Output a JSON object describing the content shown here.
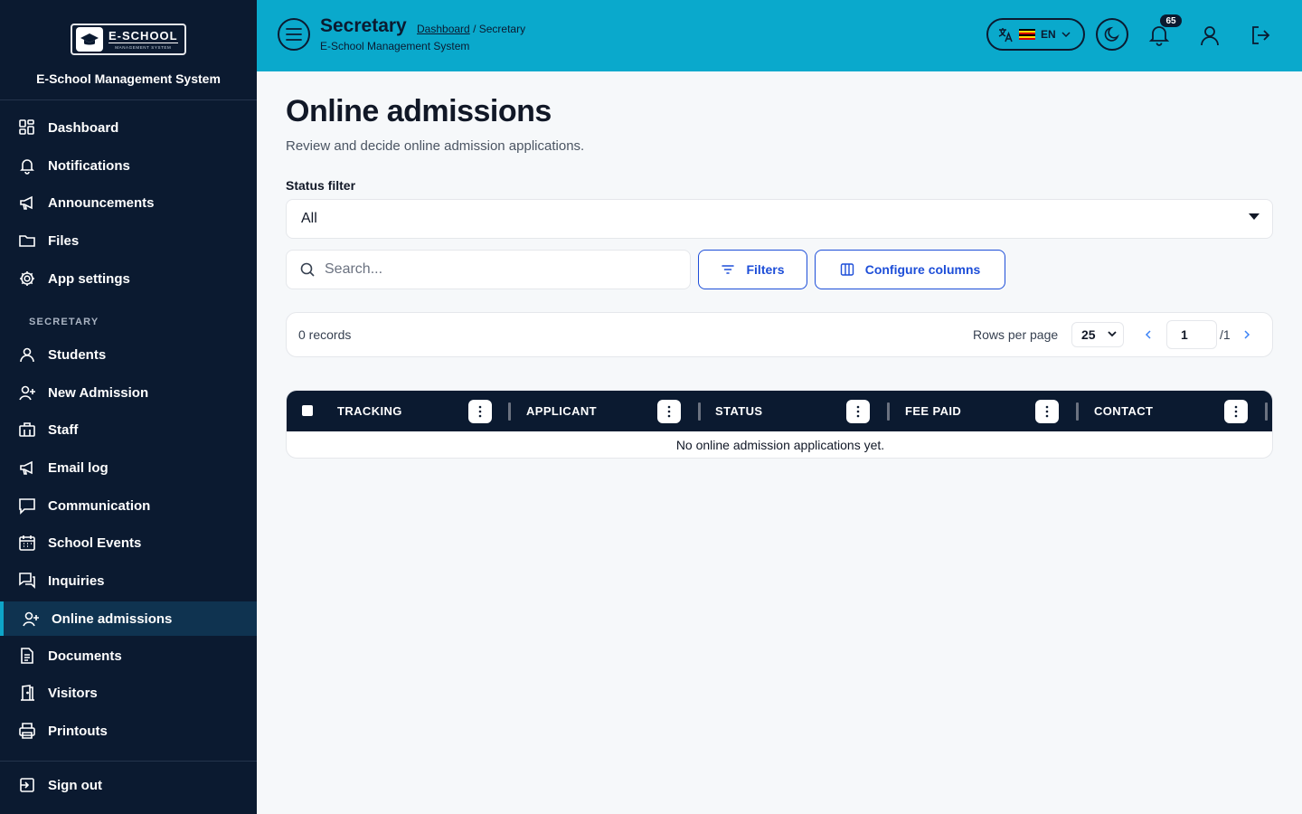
{
  "brand": {
    "logo_title": "E-SCHOOL",
    "logo_subtitle": "MANAGEMENT SYSTEM",
    "name": "E-School Management System"
  },
  "sidebar": {
    "items": [
      {
        "label": "Dashboard",
        "icon": "dashboard-grid-icon"
      },
      {
        "label": "Notifications",
        "icon": "bell-icon"
      },
      {
        "label": "Announcements",
        "icon": "megaphone-icon"
      },
      {
        "label": "Files",
        "icon": "folder-icon"
      },
      {
        "label": "App settings",
        "icon": "gear-icon"
      }
    ],
    "section_title": "SECRETARY",
    "section_items": [
      {
        "label": "Students",
        "icon": "user-icon"
      },
      {
        "label": "New Admission",
        "icon": "user-plus-icon"
      },
      {
        "label": "Staff",
        "icon": "staff-icon"
      },
      {
        "label": "Email log",
        "icon": "megaphone-icon"
      },
      {
        "label": "Communication",
        "icon": "chat-icon"
      },
      {
        "label": "School Events",
        "icon": "calendar-icon"
      },
      {
        "label": "Inquiries",
        "icon": "inquiries-icon"
      },
      {
        "label": "Online admissions",
        "icon": "user-plus-icon",
        "active": true
      },
      {
        "label": "Documents",
        "icon": "document-icon"
      },
      {
        "label": "Visitors",
        "icon": "door-icon"
      },
      {
        "label": "Printouts",
        "icon": "printer-icon"
      }
    ],
    "signout_label": "Sign out"
  },
  "header": {
    "title": "Secretary",
    "breadcrumb_link": "Dashboard",
    "breadcrumb_current": "/ Secretary",
    "subtitle": "E-School Management System",
    "language": "EN",
    "notification_count": "65"
  },
  "main": {
    "title": "Online admissions",
    "description": "Review and decide online admission applications.",
    "status_filter_label": "Status filter",
    "status_filter_value": "All",
    "search_placeholder": "Search...",
    "filters_label": "Filters",
    "configure_columns_label": "Configure columns",
    "records_count": "0 records",
    "rows_per_page_label": "Rows per page",
    "rows_per_page_value": "25",
    "page_current": "1",
    "page_total": "/1",
    "columns": [
      "TRACKING",
      "APPLICANT",
      "STATUS",
      "FEE PAID",
      "CONTACT"
    ],
    "empty_message": "No online admission applications yet."
  },
  "colors": {
    "sidebar_bg": "#0b1a30",
    "header_bg": "#0aa9cc",
    "accent_blue": "#1d4ed8",
    "active_item_bg": "#0f3350"
  }
}
